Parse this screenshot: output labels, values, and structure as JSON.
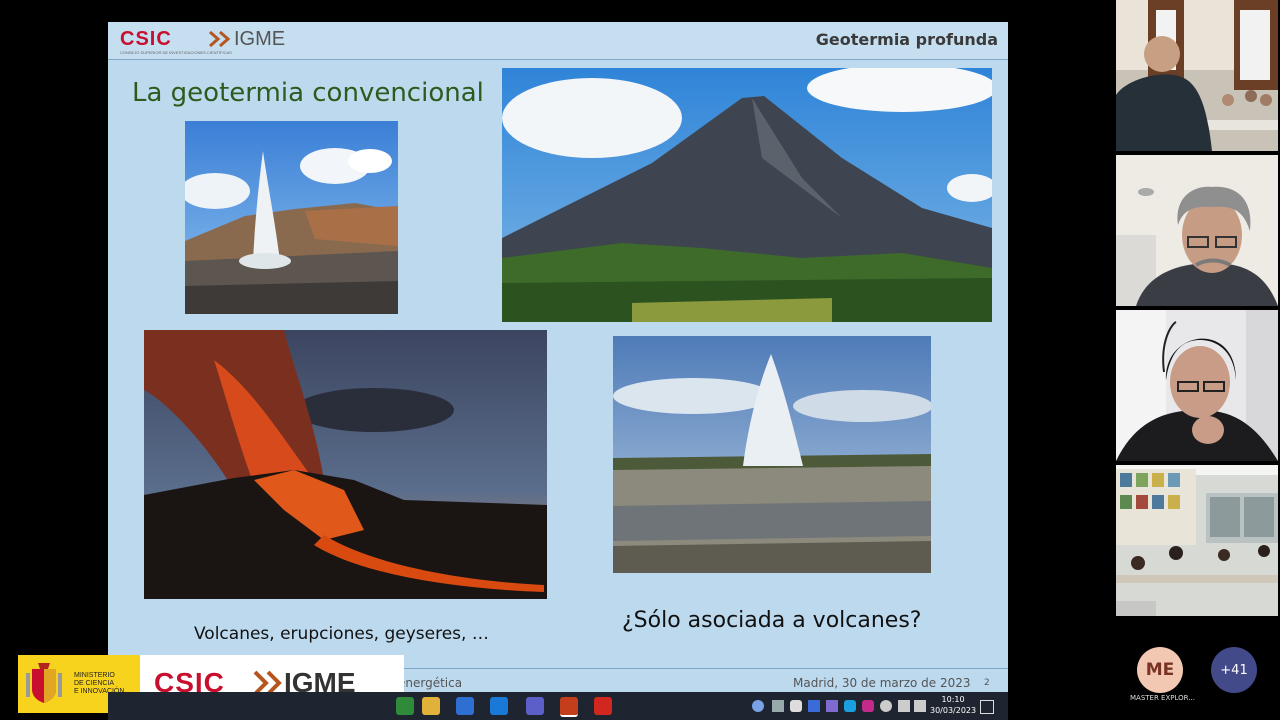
{
  "slide": {
    "header_logo_csic": "CSIC",
    "header_logo_csic_sub": "CONSEJO SUPERIOR DE INVESTIGACIONES CIENTÍFICAS",
    "header_logo_igme": "IGME",
    "header_title": "Geotermia profunda",
    "title": "La geotermia convencional",
    "caption_left": "Volcanes, erupciones, geyseres, …",
    "caption_right": "¿Sólo asociada a volcanes?",
    "footer_left": "energética",
    "footer_date": "Madrid, 30 de marzo de 2023",
    "page_number": "2"
  },
  "banner": {
    "ministry": "MINISTERIO\nDE CIENCIA\nE INNOVACIÓN",
    "csic": "CSIC",
    "igme": "IGME"
  },
  "taskbar": {
    "time": "10:10",
    "date": "30/03/2023"
  },
  "participants": {
    "avatar_initials": "ME",
    "avatar_name": "MASTER EXPLOR...",
    "more_count": "+41"
  },
  "colors": {
    "slide_bg": "#bcd9ee",
    "title_green": "#2e5a1e",
    "csic_red": "#c8102e",
    "more_button": "#434a8a"
  }
}
